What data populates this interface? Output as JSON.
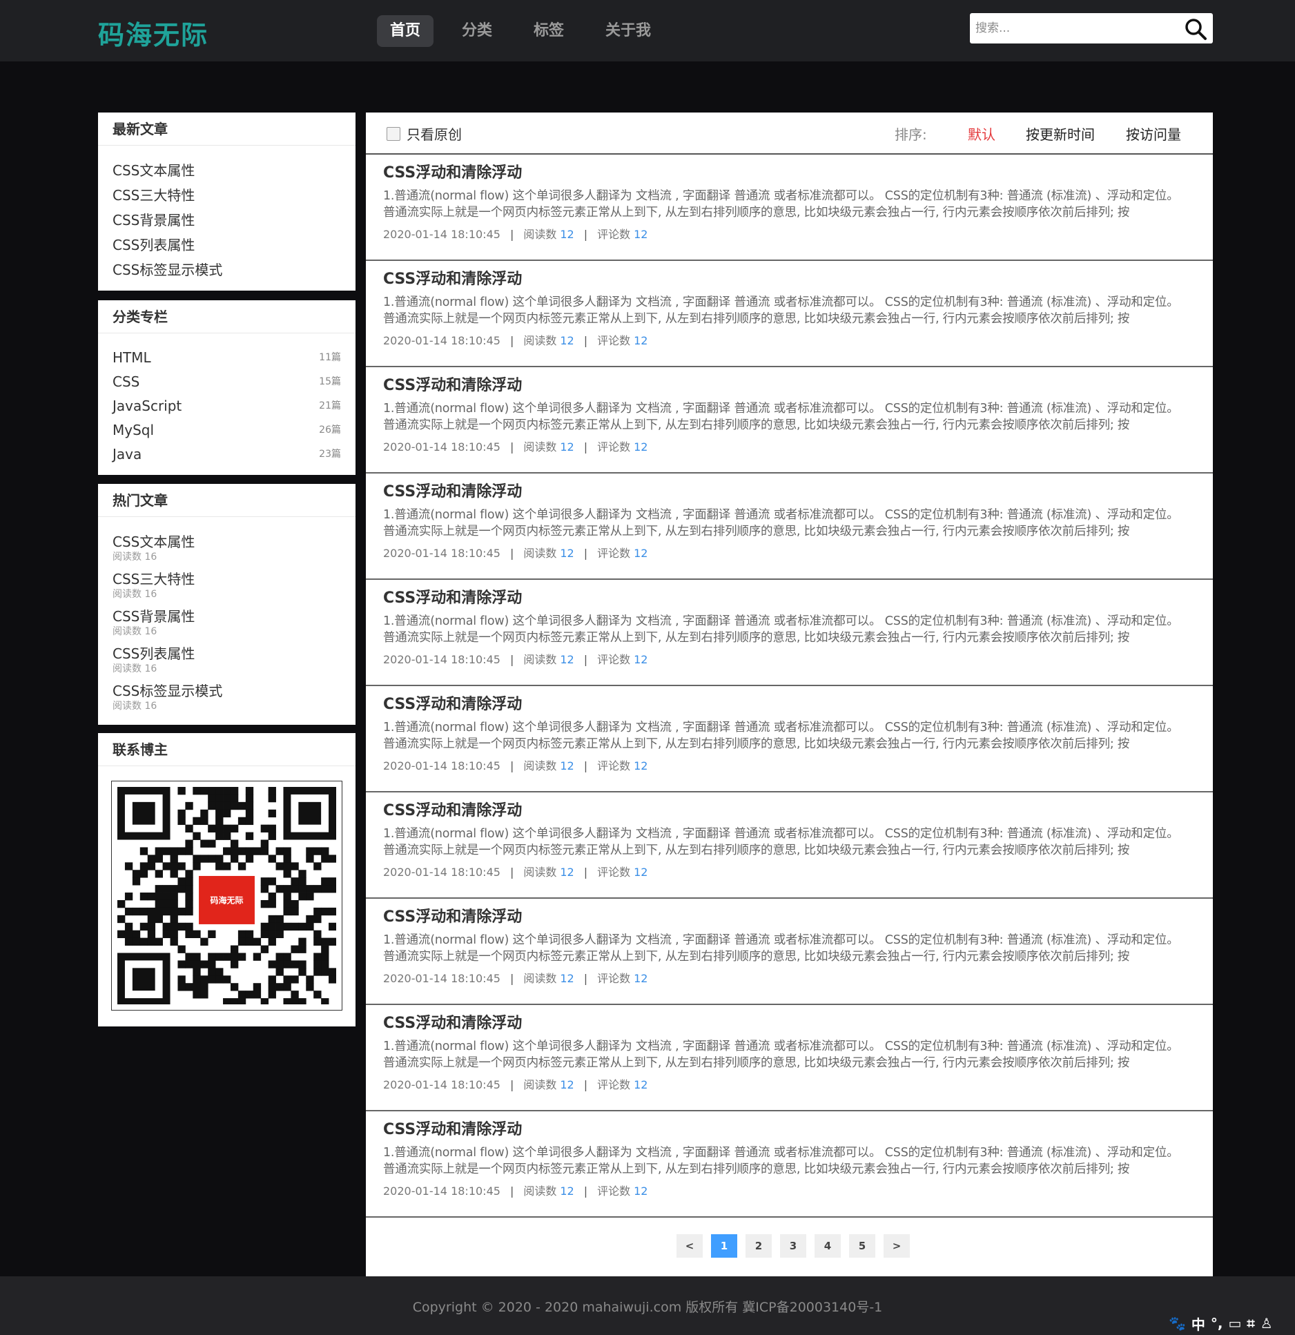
{
  "header": {
    "logo": "码海无际",
    "nav": [
      "首页",
      "分类",
      "标签",
      "关于我"
    ],
    "search_placeholder": "搜索..."
  },
  "sidebar": {
    "latest": {
      "title": "最新文章",
      "items": [
        "CSS文本属性",
        "CSS三大特性",
        "CSS背景属性",
        "CSS列表属性",
        "CSS标签显示模式"
      ]
    },
    "categories": {
      "title": "分类专栏",
      "items": [
        {
          "name": "HTML",
          "count": "11篇"
        },
        {
          "name": "CSS",
          "count": "15篇"
        },
        {
          "name": "JavaScript",
          "count": "21篇"
        },
        {
          "name": "MySql",
          "count": "26篇"
        },
        {
          "name": "Java",
          "count": "23篇"
        }
      ]
    },
    "hot": {
      "title": "热门文章",
      "items": [
        {
          "title": "CSS文本属性",
          "reads": "阅读数 16"
        },
        {
          "title": "CSS三大特性",
          "reads": "阅读数 16"
        },
        {
          "title": "CSS背景属性",
          "reads": "阅读数 16"
        },
        {
          "title": "CSS列表属性",
          "reads": "阅读数 16"
        },
        {
          "title": "CSS标签显示模式",
          "reads": "阅读数 16"
        }
      ]
    },
    "contact": {
      "title": "联系博主",
      "qr_logo_text": "码海无际"
    }
  },
  "filter": {
    "original_only": "只看原创",
    "sort_label": "排序:",
    "sort_options": [
      "默认",
      "按更新时间",
      "按访问量"
    ]
  },
  "articles": [
    {
      "title": "CSS浮动和清除浮动",
      "excerpt": "1.普通流(normal flow) 这个单词很多人翻译为 文档流 , 字面翻译 普通流 或者标准流都可以。 CSS的定位机制有3种: 普通流 (标准流) 、浮动和定位。 普通流实际上就是一个网页内标签元素正常从上到下, 从左到右排列顺序的意思, 比如块级元素会独占一行, 行内元素会按顺序依次前后排列; 按",
      "date": "2020-01-14 18:10:45",
      "reads_label": "阅读数",
      "reads": "12",
      "comments_label": "评论数",
      "comments": "12"
    },
    {
      "title": "CSS浮动和清除浮动",
      "excerpt": "1.普通流(normal flow) 这个单词很多人翻译为 文档流 , 字面翻译 普通流 或者标准流都可以。 CSS的定位机制有3种: 普通流 (标准流) 、浮动和定位。 普通流实际上就是一个网页内标签元素正常从上到下, 从左到右排列顺序的意思, 比如块级元素会独占一行, 行内元素会按顺序依次前后排列; 按",
      "date": "2020-01-14 18:10:45",
      "reads_label": "阅读数",
      "reads": "12",
      "comments_label": "评论数",
      "comments": "12"
    },
    {
      "title": "CSS浮动和清除浮动",
      "excerpt": "1.普通流(normal flow) 这个单词很多人翻译为 文档流 , 字面翻译 普通流 或者标准流都可以。 CSS的定位机制有3种: 普通流 (标准流) 、浮动和定位。 普通流实际上就是一个网页内标签元素正常从上到下, 从左到右排列顺序的意思, 比如块级元素会独占一行, 行内元素会按顺序依次前后排列; 按",
      "date": "2020-01-14 18:10:45",
      "reads_label": "阅读数",
      "reads": "12",
      "comments_label": "评论数",
      "comments": "12"
    },
    {
      "title": "CSS浮动和清除浮动",
      "excerpt": "1.普通流(normal flow) 这个单词很多人翻译为 文档流 , 字面翻译 普通流 或者标准流都可以。 CSS的定位机制有3种: 普通流 (标准流) 、浮动和定位。 普通流实际上就是一个网页内标签元素正常从上到下, 从左到右排列顺序的意思, 比如块级元素会独占一行, 行内元素会按顺序依次前后排列; 按",
      "date": "2020-01-14 18:10:45",
      "reads_label": "阅读数",
      "reads": "12",
      "comments_label": "评论数",
      "comments": "12"
    },
    {
      "title": "CSS浮动和清除浮动",
      "excerpt": "1.普通流(normal flow) 这个单词很多人翻译为 文档流 , 字面翻译 普通流 或者标准流都可以。 CSS的定位机制有3种: 普通流 (标准流) 、浮动和定位。 普通流实际上就是一个网页内标签元素正常从上到下, 从左到右排列顺序的意思, 比如块级元素会独占一行, 行内元素会按顺序依次前后排列; 按",
      "date": "2020-01-14 18:10:45",
      "reads_label": "阅读数",
      "reads": "12",
      "comments_label": "评论数",
      "comments": "12"
    },
    {
      "title": "CSS浮动和清除浮动",
      "excerpt": "1.普通流(normal flow) 这个单词很多人翻译为 文档流 , 字面翻译 普通流 或者标准流都可以。 CSS的定位机制有3种: 普通流 (标准流) 、浮动和定位。 普通流实际上就是一个网页内标签元素正常从上到下, 从左到右排列顺序的意思, 比如块级元素会独占一行, 行内元素会按顺序依次前后排列; 按",
      "date": "2020-01-14 18:10:45",
      "reads_label": "阅读数",
      "reads": "12",
      "comments_label": "评论数",
      "comments": "12"
    },
    {
      "title": "CSS浮动和清除浮动",
      "excerpt": "1.普通流(normal flow) 这个单词很多人翻译为 文档流 , 字面翻译 普通流 或者标准流都可以。 CSS的定位机制有3种: 普通流 (标准流) 、浮动和定位。 普通流实际上就是一个网页内标签元素正常从上到下, 从左到右排列顺序的意思, 比如块级元素会独占一行, 行内元素会按顺序依次前后排列; 按",
      "date": "2020-01-14 18:10:45",
      "reads_label": "阅读数",
      "reads": "12",
      "comments_label": "评论数",
      "comments": "12"
    },
    {
      "title": "CSS浮动和清除浮动",
      "excerpt": "1.普通流(normal flow) 这个单词很多人翻译为 文档流 , 字面翻译 普通流 或者标准流都可以。 CSS的定位机制有3种: 普通流 (标准流) 、浮动和定位。 普通流实际上就是一个网页内标签元素正常从上到下, 从左到右排列顺序的意思, 比如块级元素会独占一行, 行内元素会按顺序依次前后排列; 按",
      "date": "2020-01-14 18:10:45",
      "reads_label": "阅读数",
      "reads": "12",
      "comments_label": "评论数",
      "comments": "12"
    },
    {
      "title": "CSS浮动和清除浮动",
      "excerpt": "1.普通流(normal flow) 这个单词很多人翻译为 文档流 , 字面翻译 普通流 或者标准流都可以。 CSS的定位机制有3种: 普通流 (标准流) 、浮动和定位。 普通流实际上就是一个网页内标签元素正常从上到下, 从左到右排列顺序的意思, 比如块级元素会独占一行, 行内元素会按顺序依次前后排列; 按",
      "date": "2020-01-14 18:10:45",
      "reads_label": "阅读数",
      "reads": "12",
      "comments_label": "评论数",
      "comments": "12"
    },
    {
      "title": "CSS浮动和清除浮动",
      "excerpt": "1.普通流(normal flow) 这个单词很多人翻译为 文档流 , 字面翻译 普通流 或者标准流都可以。 CSS的定位机制有3种: 普通流 (标准流) 、浮动和定位。 普通流实际上就是一个网页内标签元素正常从上到下, 从左到右排列顺序的意思, 比如块级元素会独占一行, 行内元素会按顺序依次前后排列; 按",
      "date": "2020-01-14 18:10:45",
      "reads_label": "阅读数",
      "reads": "12",
      "comments_label": "评论数",
      "comments": "12"
    }
  ],
  "pagination": {
    "prev": "<",
    "pages": [
      "1",
      "2",
      "3",
      "4",
      "5"
    ],
    "next": ">",
    "current": "1"
  },
  "footer": {
    "copyright": "Copyright © 2020 - 2020 mahaiwuji.com 版权所有 冀ICP备20003140号-1"
  },
  "ime_toolbar": [
    "中",
    "°,"
  ],
  "colors": {
    "accent": "#1fa39a",
    "sort_active": "#e4393c",
    "link_blue": "#3a8ee6",
    "page_active": "#409eff"
  }
}
